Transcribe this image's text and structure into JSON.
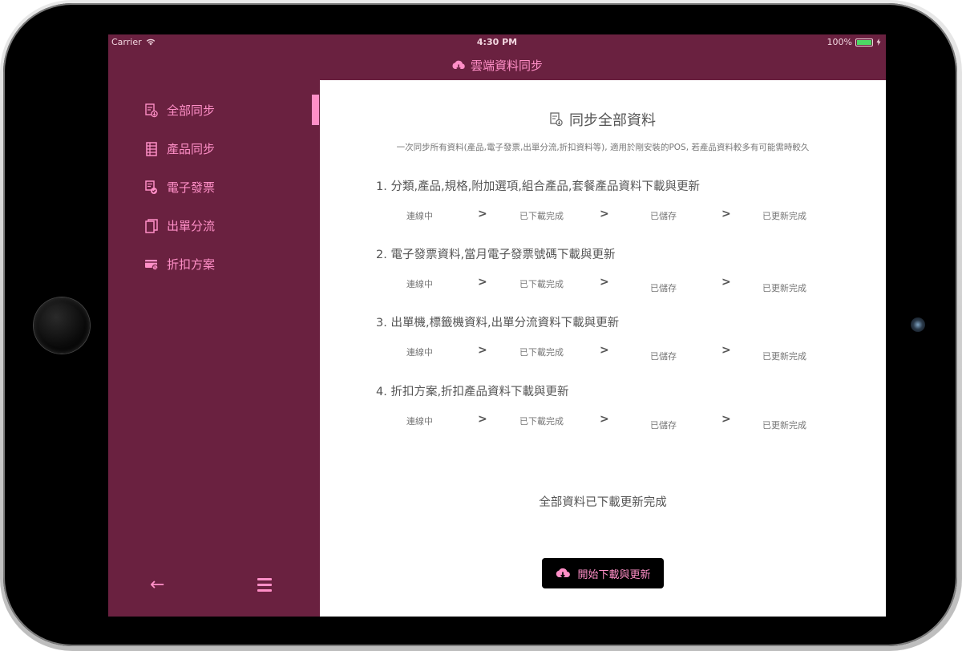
{
  "status_bar": {
    "carrier": "Carrier",
    "time": "4:30 PM",
    "battery": "100%"
  },
  "nav": {
    "title": "雲端資料同步"
  },
  "sidebar": {
    "items": [
      {
        "label": "全部同步",
        "icon": "document-sync-icon"
      },
      {
        "label": "產品同步",
        "icon": "list-icon"
      },
      {
        "label": "電子發票",
        "icon": "invoice-icon"
      },
      {
        "label": "出單分流",
        "icon": "copy-icon"
      },
      {
        "label": "折扣方案",
        "icon": "discount-card-icon"
      }
    ],
    "back_icon": "←"
  },
  "content": {
    "title": "同步全部資料",
    "description": "一次同步所有資料(產品,電子發票,出單分流,折扣資料等), 適用於剛安裝的POS, 若產品資料較多有可能需時較久",
    "sections": [
      {
        "title": "1. 分類,產品,規格,附加選項,組合產品,套餐產品資料下載與更新",
        "steps": [
          "連線中",
          "已下載完成",
          "已儲存",
          "已更新完成"
        ]
      },
      {
        "title": "2. 電子發票資料,當月電子發票號碼下載與更新",
        "steps": [
          "連線中",
          "已下載完成",
          "已儲存",
          "已更新完成"
        ]
      },
      {
        "title": "3. 出單機,標籤機資料,出單分流資料下載與更新",
        "steps": [
          "連線中",
          "已下載完成",
          "已儲存",
          "已更新完成"
        ]
      },
      {
        "title": "4. 折扣方案,折扣產品資料下載與更新",
        "steps": [
          "連線中",
          "已下載完成",
          "已儲存",
          "已更新完成"
        ]
      }
    ],
    "chevron": ">",
    "complete_text": "全部資料已下載更新完成",
    "start_button": "開始下載與更新"
  },
  "colors": {
    "accent": "#ff8fc7",
    "sidebar_bg": "#6a2140",
    "button_bg": "#000000"
  }
}
